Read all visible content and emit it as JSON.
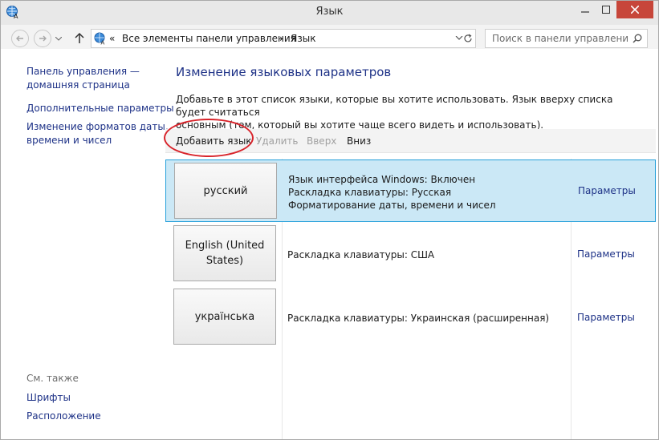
{
  "window": {
    "title": "Язык",
    "colors": {
      "close_button": "#c7463a",
      "link": "#1e3287",
      "selection": "#cbe8f6",
      "highlight_oval": "#d8232a"
    }
  },
  "address": {
    "crumb_root": "«",
    "crumb_1": "Все элементы панели управления",
    "crumb_sep": "›",
    "crumb_2": "Язык",
    "search_placeholder": "Поиск в панели управления"
  },
  "sidebar": {
    "home_line1": "Панель управления —",
    "home_line2": "домашняя страница",
    "advanced": "Дополнительные параметры",
    "formats_line1": "Изменение форматов даты,",
    "formats_line2": "времени и чисел",
    "see_also": "См. также",
    "fonts": "Шрифты",
    "location": "Расположение"
  },
  "main": {
    "title": "Изменение языковых параметров",
    "desc_line1": "Добавьте в этот список языки, которые вы хотите использовать. Язык вверху списка будет считаться",
    "desc_line2": "основным (тем, который вы хотите чаще всего видеть и использовать)."
  },
  "toolbar": {
    "add": "Добавить язык",
    "remove": "Удалить",
    "up": "Вверх",
    "down": "Вниз"
  },
  "languages": [
    {
      "name_line1": "русский",
      "name_line2": "",
      "info_line1": "Язык интерфейса Windows: Включен",
      "info_line2": "Раскладка клавиатуры: Русская",
      "info_line3": "Форматирование даты, времени и чисел",
      "params": "Параметры"
    },
    {
      "name_line1": "English (United",
      "name_line2": "States)",
      "info_line1": "Раскладка клавиатуры: США",
      "params": "Параметры"
    },
    {
      "name_line1": "українська",
      "name_line2": "",
      "info_line1": "Раскладка клавиатуры: Украинская (расширенная)",
      "params": "Параметры"
    }
  ],
  "icons": {
    "app": "language-icon",
    "back": "back-arrow-icon",
    "forward": "forward-arrow-icon",
    "up": "up-arrow-icon",
    "dropdown": "chevron-down-icon",
    "refresh": "refresh-icon",
    "search": "search-icon"
  }
}
